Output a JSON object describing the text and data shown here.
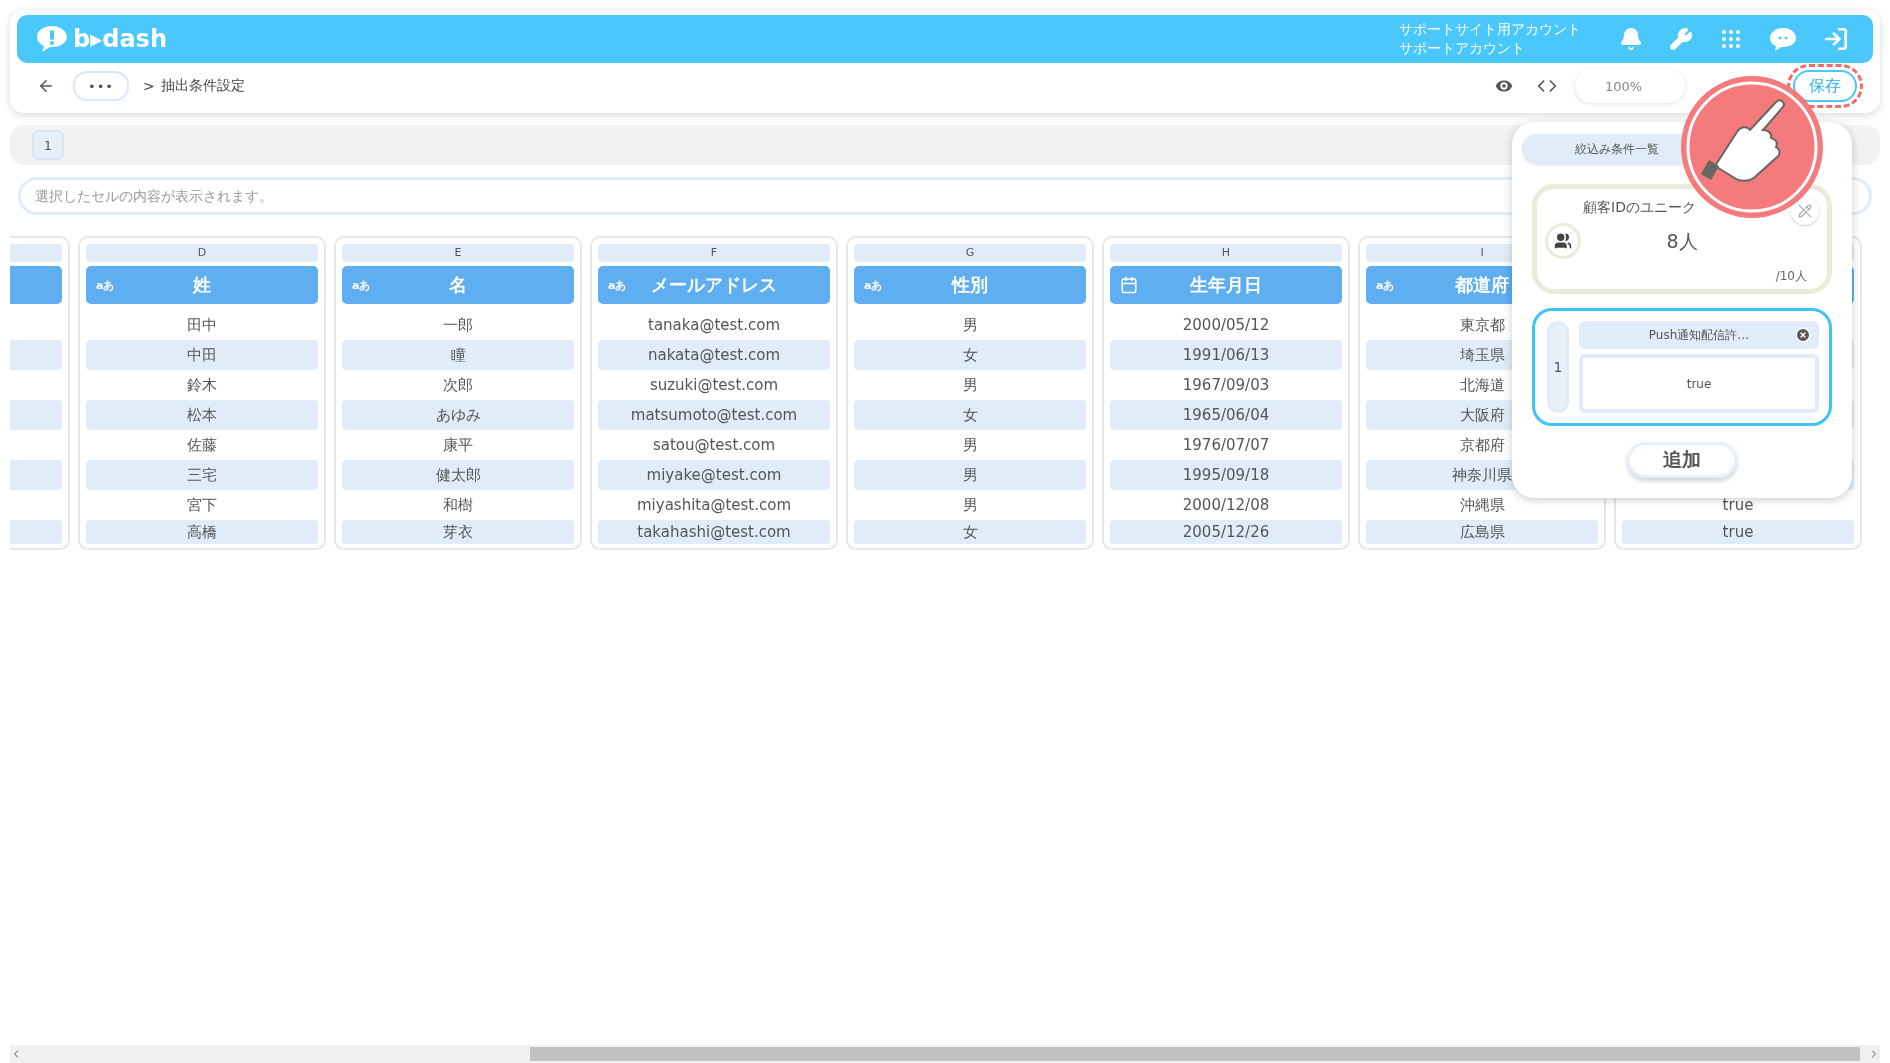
{
  "header": {
    "logo": "b▸dash",
    "account_lines": [
      "サポートサイト用アカウント",
      "サポートアカウント"
    ]
  },
  "breadcrumb": {
    "more": "•••",
    "separator": ">",
    "current": "抽出条件設定"
  },
  "toolbar": {
    "zoom": "100%",
    "save": "保存"
  },
  "sheet_tabs": [
    {
      "label": "1",
      "selected": true
    }
  ],
  "cell_field": {
    "placeholder": "選択したセルの内容が表示されます。"
  },
  "columns": [
    {
      "kind": "partial"
    },
    {
      "kind": "text",
      "letter": "D",
      "type_label": "aあ",
      "title": "姓",
      "cells": [
        "田中",
        "中田",
        "鈴木",
        "松本",
        "佐藤",
        "三宅",
        "宮下",
        "高橋"
      ]
    },
    {
      "kind": "text",
      "letter": "E",
      "type_label": "aあ",
      "title": "名",
      "cells": [
        "一郎",
        "瞳",
        "次郎",
        "あゆみ",
        "康平",
        "健太郎",
        "和樹",
        "芽衣"
      ]
    },
    {
      "kind": "text",
      "letter": "F",
      "type_label": "aあ",
      "title": "メールアドレス",
      "cells": [
        "tanaka@test.com",
        "nakata@test.com",
        "suzuki@test.com",
        "matsumoto@test.com",
        "satou@test.com",
        "miyake@test.com",
        "miyashita@test.com",
        "takahashi@test.com"
      ]
    },
    {
      "kind": "text",
      "letter": "G",
      "type_label": "aあ",
      "title": "性別",
      "cells": [
        "男",
        "女",
        "男",
        "女",
        "男",
        "男",
        "男",
        "女"
      ]
    },
    {
      "kind": "date",
      "letter": "H",
      "title": "生年月日",
      "cells": [
        "2000/05/12",
        "1991/06/13",
        "1967/09/03",
        "1965/06/04",
        "1976/07/07",
        "1995/09/18",
        "2000/12/08",
        "2005/12/26"
      ]
    },
    {
      "kind": "text",
      "letter": "I",
      "type_label": "aあ",
      "title": "都道府",
      "cells": [
        "東京都",
        "埼玉県",
        "北海道",
        "大阪府",
        "京都府",
        "神奈川県",
        "沖縄県",
        "広島県"
      ]
    },
    {
      "kind": "covered",
      "cells": [
        "true",
        "true"
      ]
    }
  ],
  "filter_panel": {
    "tabs": [
      {
        "label": "絞込み条件一覧",
        "selected": true
      }
    ],
    "summary": {
      "title": "顧客IDのユニーク",
      "count": "8人",
      "total": "/10人"
    },
    "conditions": [
      {
        "index": "1",
        "name": "Push通知配信許…",
        "value": "true"
      }
    ],
    "add_button": "追加"
  }
}
